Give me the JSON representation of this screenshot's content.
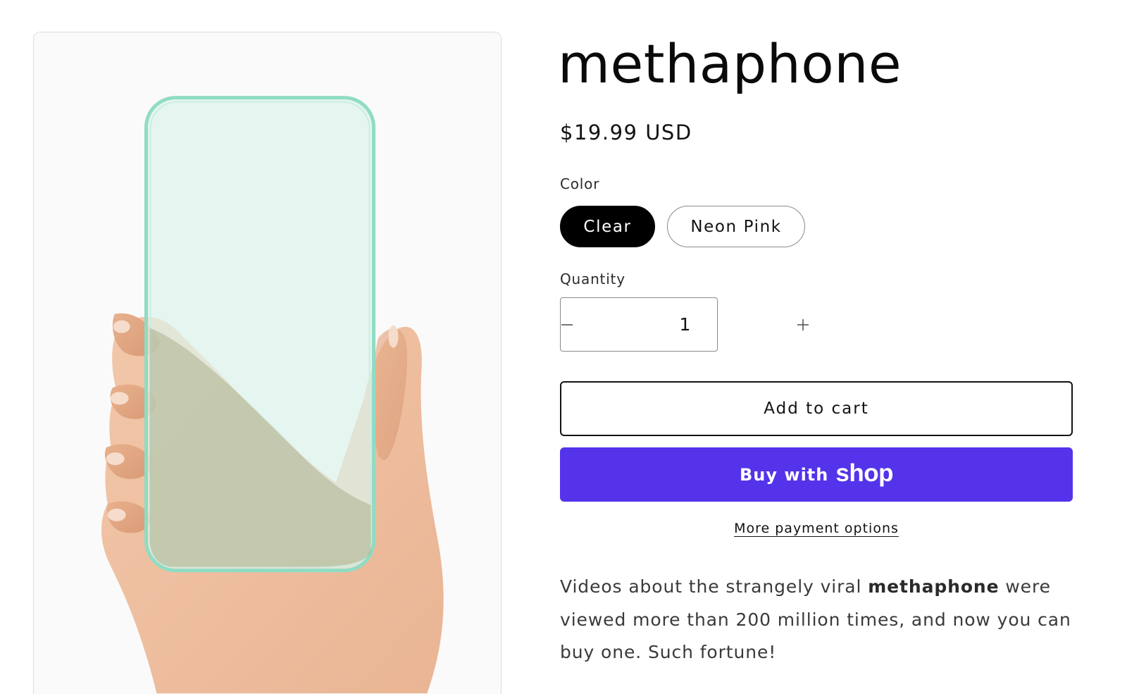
{
  "product": {
    "title": "methaphone",
    "price": "$19.99 USD",
    "description_before": "Videos about the strangely viral ",
    "description_bold": "methaphone",
    "description_after": " were viewed more than 200 million times, and now you can buy one. Such fortune!"
  },
  "color_option": {
    "label": "Color",
    "options": [
      "Clear",
      "Neon Pink"
    ],
    "selected": "Clear"
  },
  "quantity": {
    "label": "Quantity",
    "value": "1",
    "decrement_symbol": "−",
    "increment_symbol": "+"
  },
  "actions": {
    "add_to_cart": "Add to cart",
    "buy_with": "Buy with",
    "shop_brand": "shop",
    "more_payment_options": "More payment options"
  },
  "colors": {
    "shop_button": "#5433eb",
    "selected_pill": "#000000",
    "phone_tint": "#ddf3ea",
    "phone_edge": "#8fdcc4"
  },
  "icons": {
    "minus": "minus-icon",
    "plus": "plus-icon"
  }
}
